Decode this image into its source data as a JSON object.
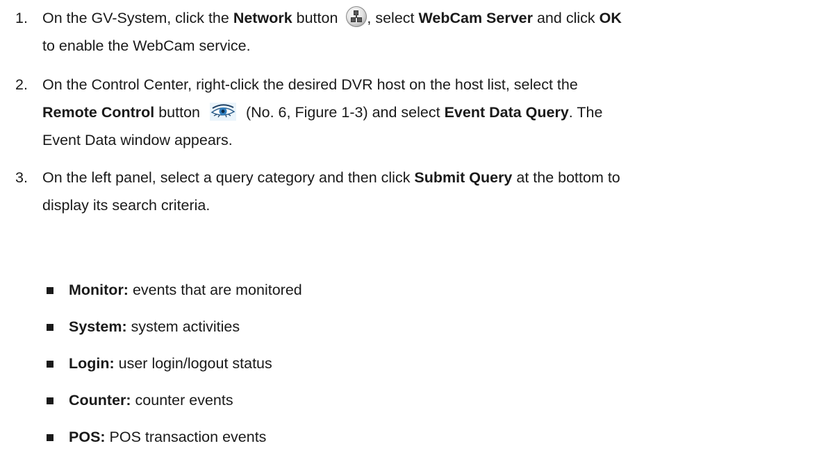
{
  "steps": [
    {
      "number": "1.",
      "line1": {
        "t1": "On the GV-System, click the ",
        "b1": "Network",
        "t2": " button ",
        "icon": "network-button-icon",
        "t3": ", select ",
        "b2": "WebCam Server",
        "t4": " and click ",
        "b3": "OK"
      },
      "line2": "to enable the WebCam service."
    },
    {
      "number": "2.",
      "line1": "On the Control Center, right-click the desired DVR host on the host list, select the",
      "line2": {
        "b1": "Remote Control",
        "t1": " button ",
        "icon": "remote-control-eye-icon",
        "t2": " (No. 6, Figure 1-3) and select ",
        "b2": "Event Data Query",
        "t3": ". The"
      },
      "line3": "Event Data window appears."
    },
    {
      "number": "3.",
      "line1": {
        "t1": "On the left panel, select a query category and then click ",
        "b1": "Submit Query",
        "t2": " at the bottom to"
      },
      "line2": "display its search criteria."
    }
  ],
  "bullets": [
    {
      "term": "Monitor:",
      "desc": " events that are monitored"
    },
    {
      "term": "System:",
      "desc": " system activities"
    },
    {
      "term": "Login:",
      "desc": " user login/logout status"
    },
    {
      "term": "Counter:",
      "desc": " counter events"
    },
    {
      "term": "POS:",
      "desc": " POS transaction events"
    }
  ]
}
